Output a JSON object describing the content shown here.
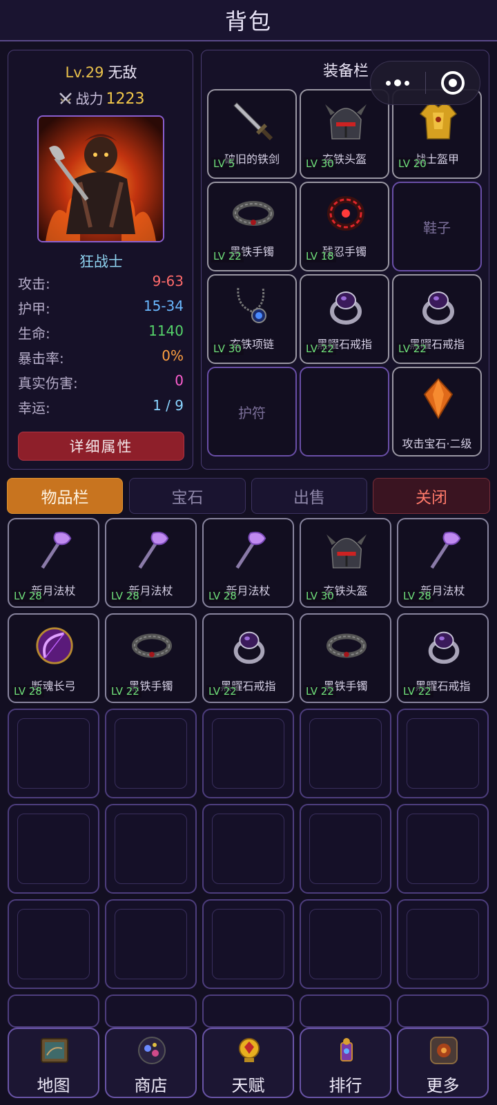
{
  "header": {
    "title": "背包"
  },
  "character": {
    "level": "Lv.29",
    "name": "无敌",
    "power_label": "战力",
    "power_value": "1223",
    "class_name": "狂战士",
    "stats": [
      {
        "label": "攻击:",
        "value": "9-63",
        "color": "#ff6b6b"
      },
      {
        "label": "护甲:",
        "value": "15-34",
        "color": "#6ab8ff"
      },
      {
        "label": "生命:",
        "value": "1140",
        "color": "#55d36a"
      },
      {
        "label": "暴击率:",
        "value": "0%",
        "color": "#ffa040"
      },
      {
        "label": "真实伤害:",
        "value": "0",
        "color": "#ff5fd0"
      },
      {
        "label": "幸运:",
        "value": "1 / 9",
        "color": "#8ad4ff"
      }
    ],
    "detail_button": "详细属性"
  },
  "equipment": {
    "title": "装备栏",
    "slots": [
      {
        "name": "破旧的铁剑",
        "level": "LV 5",
        "icon": "sword-icon"
      },
      {
        "name": "玄铁头盔",
        "level": "LV 30",
        "icon": "helmet-icon"
      },
      {
        "name": "战士盔甲",
        "level": "LV 20",
        "icon": "armor-icon"
      },
      {
        "name": "黑铁手镯",
        "level": "LV 22",
        "icon": "bracelet-icon"
      },
      {
        "name": "残忍手镯",
        "level": "LV 18",
        "icon": "red-bracelet-icon"
      },
      {
        "name": "鞋子",
        "level": "",
        "icon": ""
      },
      {
        "name": "玄铁项链",
        "level": "LV 30",
        "icon": "necklace-icon"
      },
      {
        "name": "黑曜石戒指",
        "level": "LV 22",
        "icon": "ring-icon"
      },
      {
        "name": "黑曜石戒指",
        "level": "LV 22",
        "icon": "ring-icon"
      },
      {
        "name": "护符",
        "level": "",
        "icon": ""
      },
      {
        "name": "",
        "level": "",
        "icon": ""
      },
      {
        "name": "攻击宝石·二级",
        "level": "",
        "icon": "gem-icon"
      }
    ]
  },
  "tabs": [
    {
      "label": "物品栏",
      "state": "active"
    },
    {
      "label": "宝石",
      "state": "normal"
    },
    {
      "label": "出售",
      "state": "normal"
    },
    {
      "label": "关闭",
      "state": "close"
    }
  ],
  "inventory": {
    "items": [
      {
        "name": "新月法杖",
        "level": "LV 28",
        "icon": "staff-icon"
      },
      {
        "name": "新月法杖",
        "level": "LV 28",
        "icon": "staff-icon"
      },
      {
        "name": "新月法杖",
        "level": "LV 28",
        "icon": "staff-icon"
      },
      {
        "name": "玄铁头盔",
        "level": "LV 30",
        "icon": "helmet-icon"
      },
      {
        "name": "新月法杖",
        "level": "LV 28",
        "icon": "staff-icon"
      },
      {
        "name": "断魂长弓",
        "level": "LV 28",
        "icon": "bow-icon"
      },
      {
        "name": "黑铁手镯",
        "level": "LV 22",
        "icon": "bracelet-icon"
      },
      {
        "name": "黑曜石戒指",
        "level": "LV 22",
        "icon": "ring-icon"
      },
      {
        "name": "黑铁手镯",
        "level": "LV 22",
        "icon": "bracelet-icon"
      },
      {
        "name": "黑曜石戒指",
        "level": "LV 22",
        "icon": "ring-icon"
      }
    ]
  },
  "bottom_nav": [
    {
      "label": "地图",
      "icon": "map-icon"
    },
    {
      "label": "商店",
      "icon": "shop-icon"
    },
    {
      "label": "天赋",
      "icon": "talent-icon"
    },
    {
      "label": "排行",
      "icon": "ranking-icon"
    },
    {
      "label": "更多",
      "icon": "more-icon"
    }
  ]
}
